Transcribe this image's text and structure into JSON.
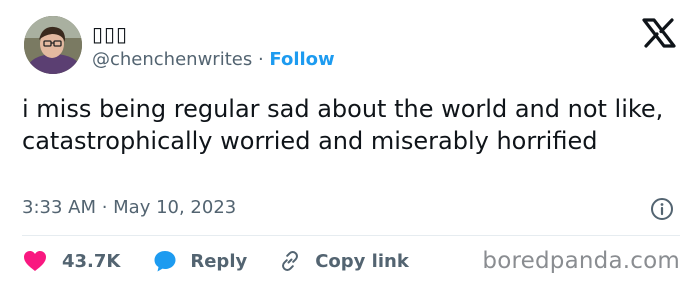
{
  "author": {
    "display_name": "▯▯▯",
    "handle": "@chenchenwrites",
    "separator": " · ",
    "follow_label": "Follow"
  },
  "tweet": {
    "text": "i miss being regular sad about the world and not like, catastrophically worried and miserably horrified",
    "timestamp": "3:33 AM · May 10, 2023"
  },
  "actions": {
    "likes": "43.7K",
    "reply": "Reply",
    "copy_link": "Copy link"
  },
  "watermark": "boredpanda.com",
  "colors": {
    "accent": "#1d9bf0",
    "heart": "#f91880",
    "text": "#0f1419",
    "muted": "#536471"
  },
  "icons": {
    "platform": "x-logo-icon",
    "info": "info-icon",
    "like": "heart-icon",
    "reply": "reply-bubble-icon",
    "copy": "link-icon"
  }
}
